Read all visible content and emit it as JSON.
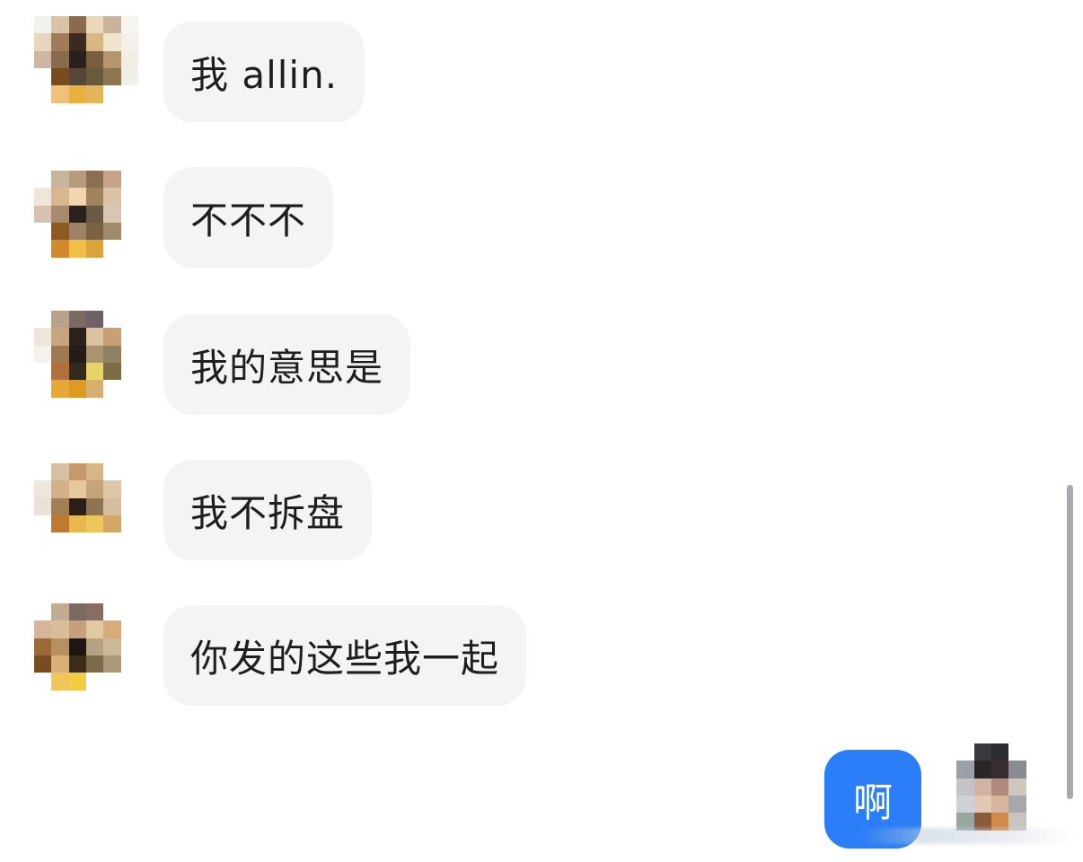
{
  "messages": [
    {
      "sender": "other",
      "text": "我 allin."
    },
    {
      "sender": "other",
      "text": "不不不"
    },
    {
      "sender": "other",
      "text": "我的意思是"
    },
    {
      "sender": "other",
      "text": "我不拆盘"
    },
    {
      "sender": "other",
      "text": "你发的这些我一起"
    },
    {
      "sender": "self",
      "text": "啊"
    }
  ],
  "colors": {
    "outgoing_bubble": "#2b7ef7",
    "incoming_bubble": "#f4f4f5",
    "text": "#1e1e1e"
  },
  "icons": [
    "pixelated-avatar",
    "pixelated-avatar-self"
  ]
}
